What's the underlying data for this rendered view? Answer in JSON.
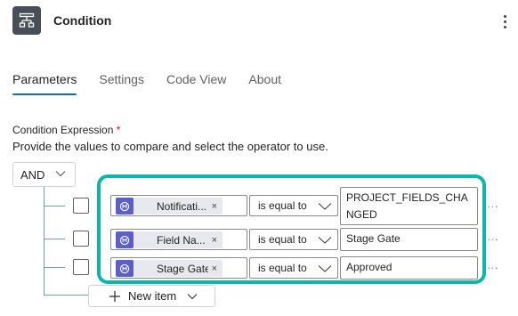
{
  "header": {
    "title": "Condition",
    "icon": "condition-icon",
    "more_icon": "more-vertical-icon"
  },
  "tabs": [
    {
      "label": "Parameters",
      "active": true
    },
    {
      "label": "Settings",
      "active": false
    },
    {
      "label": "Code View",
      "active": false
    },
    {
      "label": "About",
      "active": false
    }
  ],
  "condition": {
    "label": "Condition Expression",
    "required_marker": "*",
    "help_text": "Provide the values to compare and select the operator to use.",
    "group_operator": "AND",
    "rows": [
      {
        "operand": "Notificati...",
        "operator": "is equal to",
        "value": "PROJECT_FIELDS_CHANGED"
      },
      {
        "operand": "Field Na...",
        "operator": "is equal to",
        "value": "Stage Gate"
      },
      {
        "operand": "Stage Gate",
        "operator": "is equal to",
        "value": "Approved"
      }
    ],
    "remove_glyph": "×",
    "row_menu_glyph": "…",
    "new_item_label": "New item",
    "highlight_color": "#0eb5ad",
    "accent_color": "#0f6cbd"
  }
}
